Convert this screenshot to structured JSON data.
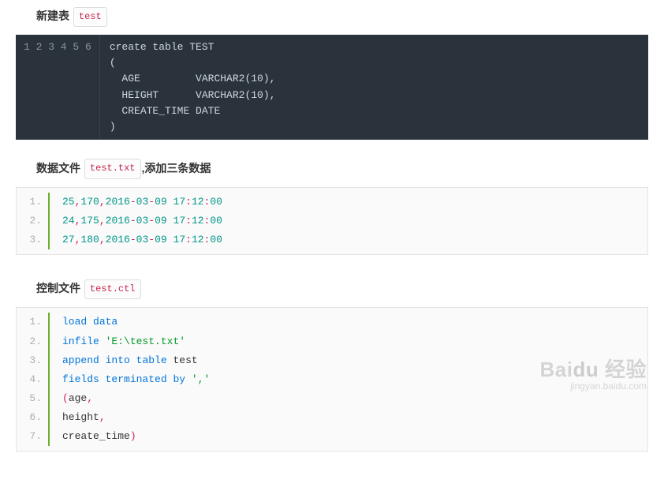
{
  "section1": {
    "prefix": "新建表",
    "tag": "test"
  },
  "code1": {
    "lines": [
      "create table TEST",
      "(",
      "  AGE         VARCHAR2(10),",
      "  HEIGHT      VARCHAR2(10),",
      "  CREATE_TIME DATE",
      ")"
    ],
    "nums": [
      "1",
      "2",
      "3",
      "4",
      "5",
      "6"
    ]
  },
  "section2": {
    "prefix": "数据文件",
    "tag": "test.txt",
    "suffix": ",添加三条数据"
  },
  "data_block": {
    "rows": [
      {
        "n": "1.",
        "a": "25",
        "b": "170",
        "date": "2016-03-09",
        "time_h": "17",
        "time_m": "12",
        "time_s": "00"
      },
      {
        "n": "2.",
        "a": "24",
        "b": "175",
        "date": "2016-03-09",
        "time_h": "17",
        "time_m": "12",
        "time_s": "00"
      },
      {
        "n": "3.",
        "a": "27",
        "b": "180",
        "date": "2016-03-09",
        "time_h": "17",
        "time_m": "12",
        "time_s": "00"
      }
    ]
  },
  "section3": {
    "prefix": "控制文件",
    "tag": "test.ctl"
  },
  "ctl_block": {
    "rows": [
      {
        "n": "1.",
        "tokens": [
          {
            "t": "load",
            "c": "kw"
          },
          {
            "t": " ",
            "c": "id"
          },
          {
            "t": "data",
            "c": "kw"
          }
        ]
      },
      {
        "n": "2.",
        "tokens": [
          {
            "t": "infile",
            "c": "kw"
          },
          {
            "t": " ",
            "c": "id"
          },
          {
            "t": "'E:\\test.txt'",
            "c": "str"
          }
        ]
      },
      {
        "n": "3.",
        "tokens": [
          {
            "t": "append",
            "c": "kw"
          },
          {
            "t": " ",
            "c": "id"
          },
          {
            "t": "into",
            "c": "typ"
          },
          {
            "t": " ",
            "c": "id"
          },
          {
            "t": "table",
            "c": "kw"
          },
          {
            "t": " ",
            "c": "id"
          },
          {
            "t": "test",
            "c": "id"
          }
        ]
      },
      {
        "n": "4.",
        "tokens": [
          {
            "t": "fields",
            "c": "kw"
          },
          {
            "t": " ",
            "c": "id"
          },
          {
            "t": "terminated",
            "c": "kw"
          },
          {
            "t": " ",
            "c": "id"
          },
          {
            "t": "by",
            "c": "typ"
          },
          {
            "t": " ",
            "c": "id"
          },
          {
            "t": "','",
            "c": "str"
          }
        ]
      },
      {
        "n": "5.",
        "tokens": [
          {
            "t": "(",
            "c": "pnk"
          },
          {
            "t": "age",
            "c": "id"
          },
          {
            "t": ",",
            "c": "pnk"
          }
        ]
      },
      {
        "n": "6.",
        "tokens": [
          {
            "t": "height",
            "c": "id"
          },
          {
            "t": ",",
            "c": "pnk"
          }
        ]
      },
      {
        "n": "7.",
        "tokens": [
          {
            "t": "create_time",
            "c": "id"
          },
          {
            "t": ")",
            "c": "pnk"
          }
        ]
      }
    ]
  },
  "watermark": {
    "brand_a": "Bai",
    "brand_b": "du",
    "brand_tail": "经验",
    "url": "jingyan.baidu.com"
  }
}
